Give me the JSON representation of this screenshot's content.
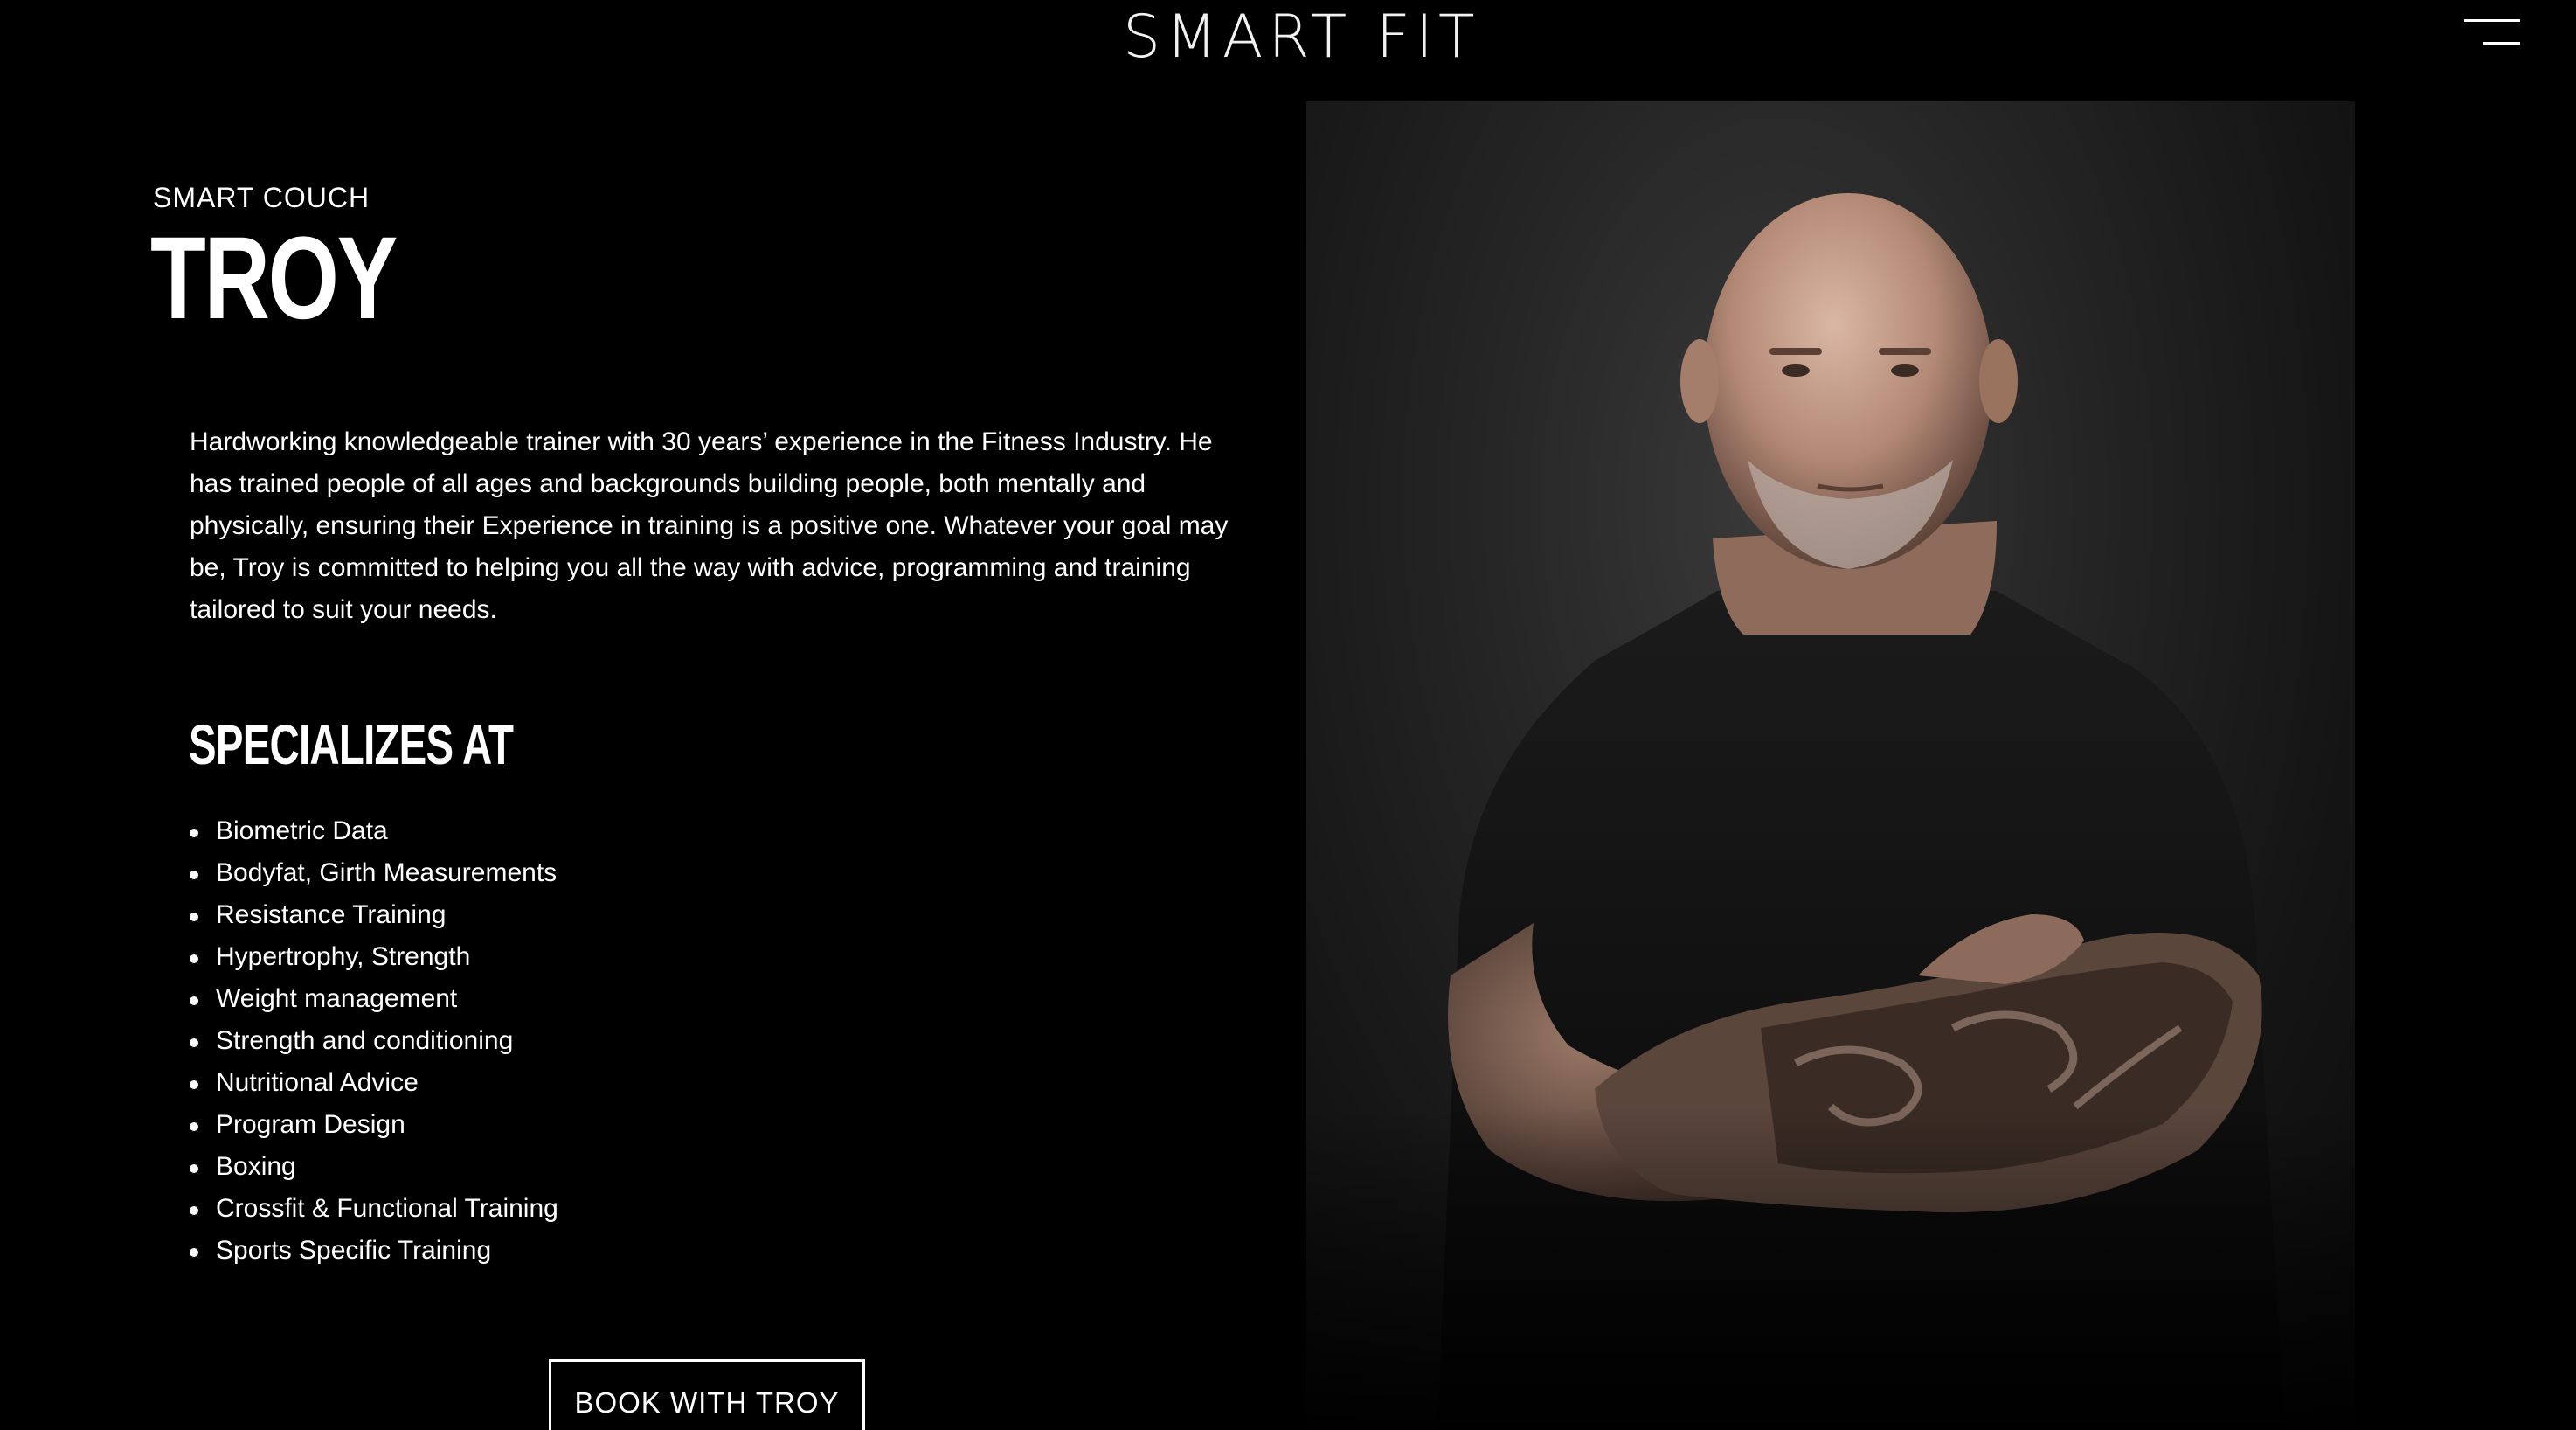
{
  "header": {
    "logo_text": "SMART FIT",
    "menu_icon": "hamburger-menu-icon"
  },
  "trainer": {
    "eyebrow": "SMART COUCH",
    "name": "TROY",
    "bio": "Hardworking knowledgeable trainer with 30 years’ experience in the Fitness Industry. He has trained people of all ages and backgrounds building people, both mentally and physically, ensuring their Experience in training is a positive one. Whatever your goal may be, Troy is committed to helping you all the way with advice, programming and training tailored to suit your needs."
  },
  "specializations": {
    "heading": "SPECIALIZES AT",
    "items": [
      "Biometric Data",
      "Bodyfat, Girth Measurements",
      "Resistance Training",
      "Hypertrophy, Strength",
      "Weight management",
      "Strength and conditioning",
      "Nutritional Advice",
      "Program Design",
      "Boxing",
      "Crossfit & Functional Training",
      "Sports Specific Training"
    ]
  },
  "cta": {
    "book_label": "BOOK WITH TROY"
  },
  "colors": {
    "background": "#000000",
    "text": "#ffffff"
  }
}
